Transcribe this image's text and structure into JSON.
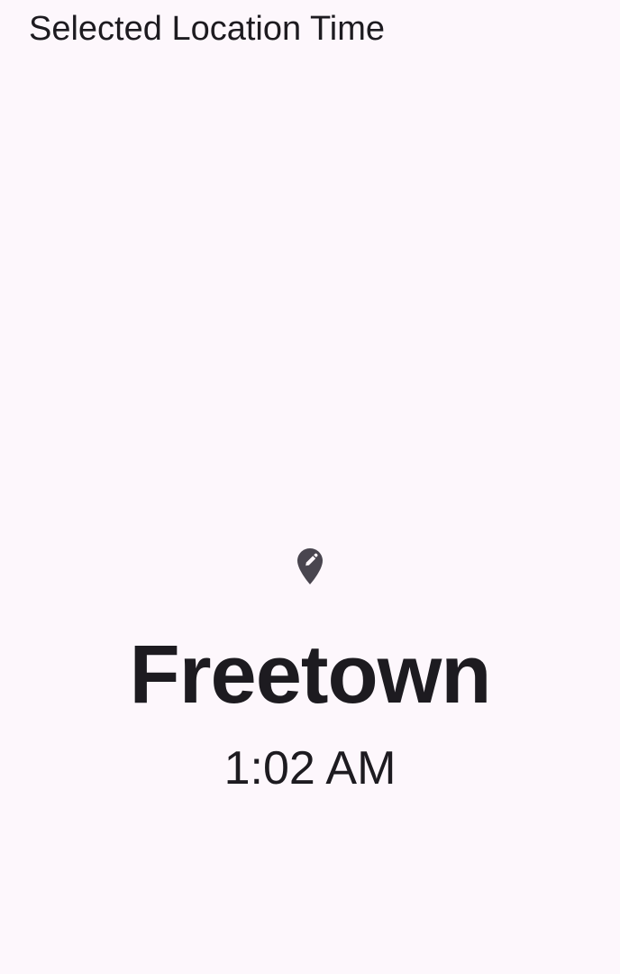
{
  "app_bar": {
    "title": "Selected Location Time"
  },
  "location": {
    "icon": "edit-location-icon",
    "city": "Freetown",
    "time": "1:02 AM"
  },
  "colors": {
    "background": "#fdf7fc",
    "text": "#1d1b20",
    "icon": "#49454f"
  }
}
